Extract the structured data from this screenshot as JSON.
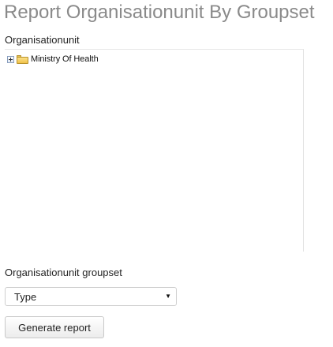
{
  "page": {
    "title": "Report Organisationunit By Groupset"
  },
  "orgunit": {
    "label": "Organisationunit",
    "tree": {
      "root_label": "Ministry Of Health",
      "root_expanded": false
    }
  },
  "groupset": {
    "label": "Organisationunit groupset",
    "selected": "Type"
  },
  "actions": {
    "generate_label": "Generate report"
  }
}
